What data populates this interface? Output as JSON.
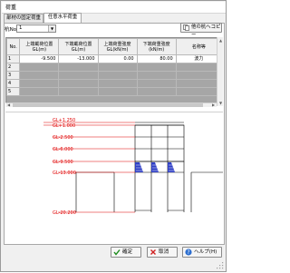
{
  "window": {
    "title": "荷重"
  },
  "tabs": [
    {
      "label": "部材の固定荷重",
      "active": false
    },
    {
      "label": "任意水平荷重",
      "active": true
    }
  ],
  "pile": {
    "label": "杭No.",
    "value": "1"
  },
  "copy_button": {
    "label": "他の杭へコピー"
  },
  "table": {
    "headers": [
      "No.",
      "上端載荷位置 GL(m)",
      "下端載荷位置 GL(m)",
      "上端荷重強度 GL(kN/m)",
      "下端荷重強度 (kN/m)",
      "名称等"
    ],
    "rows": [
      {
        "no": "1",
        "top_pos": "-9.500",
        "bottom_pos": "-13.000",
        "top_load": "0.00",
        "bottom_load": "80.00",
        "name": "波力"
      },
      {
        "no": "2"
      },
      {
        "no": "3"
      },
      {
        "no": "4"
      },
      {
        "no": "5"
      }
    ]
  },
  "diagram": {
    "levels": [
      {
        "label": "GL+1.250",
        "depth": 1.25
      },
      {
        "label": "GL+1.000",
        "depth": 1.0
      },
      {
        "label": "GL-2.500",
        "depth": -2.5
      },
      {
        "label": "GL-6.000",
        "depth": -6.0
      },
      {
        "label": "GL-9.500",
        "depth": -9.5
      },
      {
        "label": "GL-13.000",
        "depth": -13.0
      },
      {
        "label": "GL-20.200",
        "depth": -20.2
      }
    ],
    "colors": {
      "level": "#e00000",
      "load": "#2f3fc6",
      "structure": "#000000"
    }
  },
  "buttons": {
    "ok": "確定",
    "cancel": "取消",
    "help": "ヘルプ(H)"
  }
}
